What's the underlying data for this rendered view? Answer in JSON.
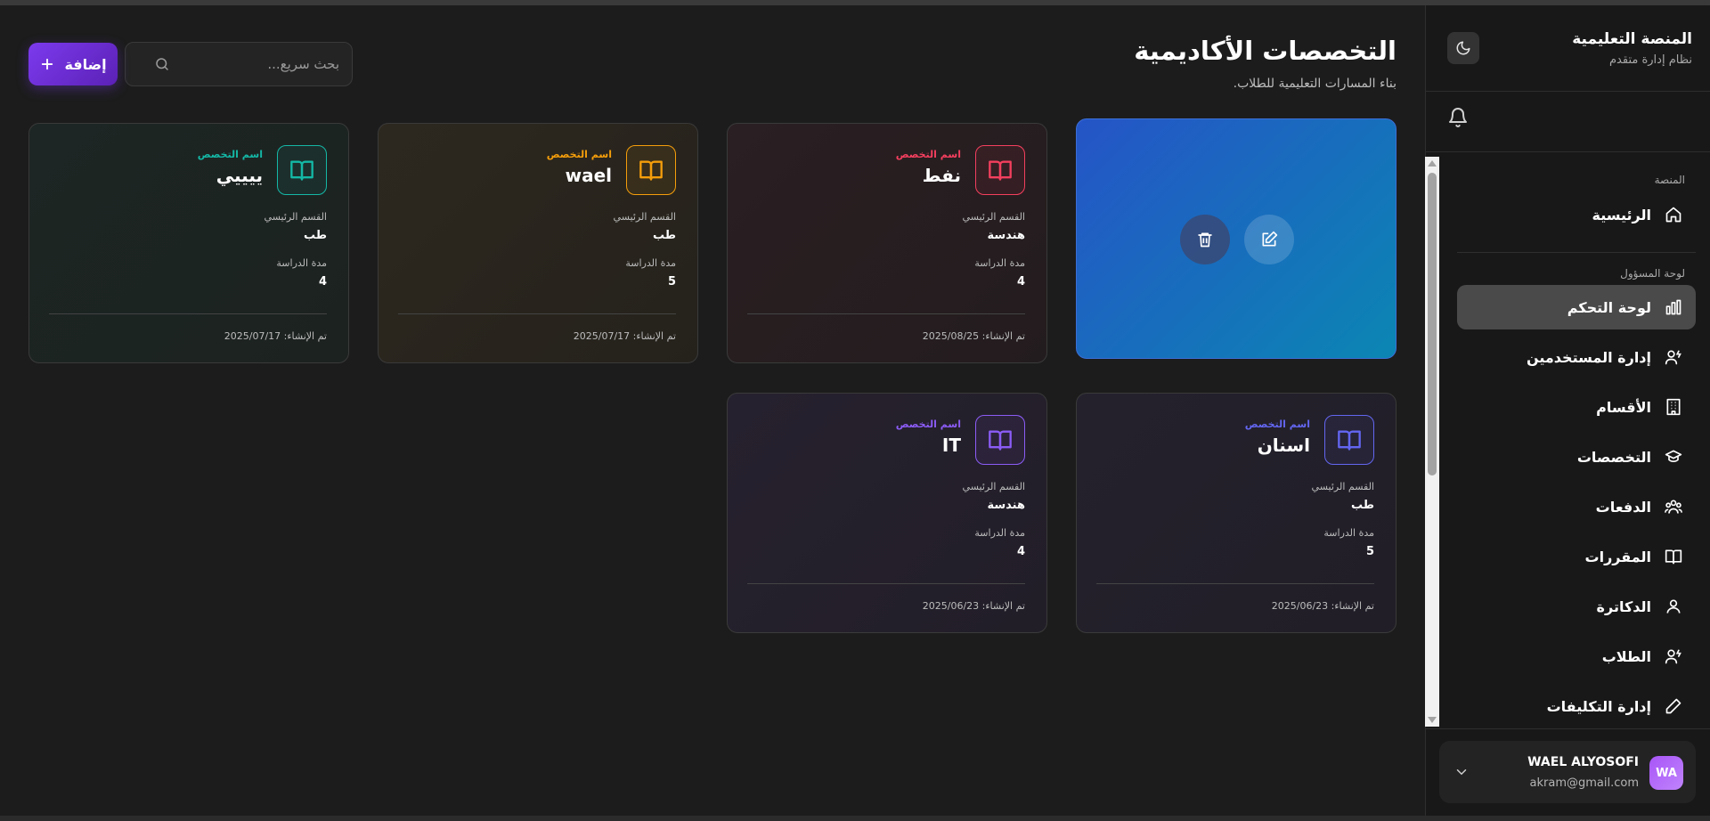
{
  "sidebar": {
    "brand_title": "المنصة التعليمية",
    "brand_subtitle": "نظام إدارة متقدم",
    "sections": {
      "platform": "المنصة",
      "admin": "لوحة المسؤول"
    },
    "items": [
      {
        "label": "الرئيسية",
        "icon": "home-icon"
      },
      {
        "label": "لوحة التحكم",
        "icon": "bar-chart-icon",
        "active": true
      },
      {
        "label": "إدارة المستخدمين",
        "icon": "users-cog-icon"
      },
      {
        "label": "الأقسام",
        "icon": "building-icon"
      },
      {
        "label": "التخصصات",
        "icon": "graduation-cap-icon"
      },
      {
        "label": "الدفعات",
        "icon": "group-icon"
      },
      {
        "label": "المقررات",
        "icon": "book-open-icon"
      },
      {
        "label": "الدكاترة",
        "icon": "user-icon"
      },
      {
        "label": "الطلاب",
        "icon": "student-icon"
      },
      {
        "label": "إدارة التكليفات",
        "icon": "pencil-icon"
      }
    ],
    "user": {
      "initials": "WA",
      "name": "WAEL ALYOSOFI",
      "email": "akram@gmail.com"
    }
  },
  "main": {
    "title": "التخصصات الأكاديمية",
    "subtitle": "بناء المسارات التعليمية للطلاب.",
    "add_label": "إضافة",
    "search_placeholder": "بحث سريع..."
  },
  "card_labels": {
    "tag": "اسم التخصص",
    "dept": "القسم الرئيسي",
    "duration": "مدة الدراسة",
    "created_prefix": "تم الإنشاء:"
  },
  "cards": [
    {
      "name": "",
      "dept": "",
      "duration": "",
      "created": "",
      "hovered": true
    },
    {
      "name": "نفط",
      "dept": "هندسة",
      "duration": "4",
      "created": "2025/08/25",
      "accent": "#f43f5e"
    },
    {
      "name": "wael",
      "dept": "طب",
      "duration": "5",
      "created": "2025/07/17",
      "accent": "#f59e0b"
    },
    {
      "name": "ييييي",
      "dept": "طب",
      "duration": "4",
      "created": "2025/07/17",
      "accent": "#14b8a6"
    },
    {
      "name": "اسنان",
      "dept": "طب",
      "duration": "5",
      "created": "2025/06/23",
      "accent": "#6366f1"
    },
    {
      "name": "IT",
      "dept": "هندسة",
      "duration": "4",
      "created": "2025/06/23",
      "accent": "#8b5cf6"
    }
  ],
  "colors": {
    "primary": "#7c3aed",
    "hover_gradient_start": "#2554c7",
    "hover_gradient_end": "#0b86b3"
  }
}
